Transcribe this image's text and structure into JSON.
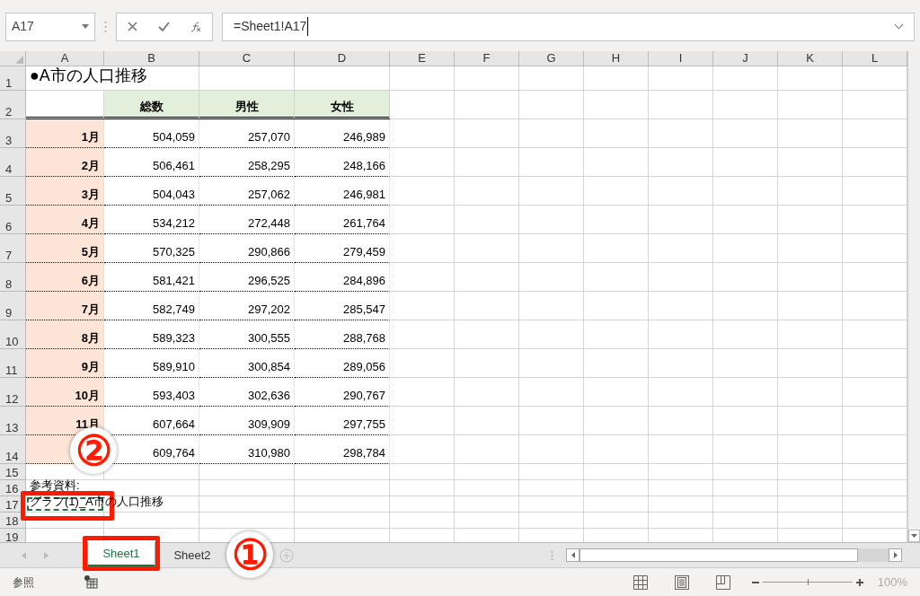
{
  "name_box": "A17",
  "formula": "=Sheet1!A17",
  "columns": [
    "A",
    "B",
    "C",
    "D",
    "E",
    "F",
    "G",
    "H",
    "I",
    "J",
    "K",
    "L"
  ],
  "rows": [
    {
      "number": "1",
      "kind": "title",
      "cells": [
        "●A市の人口推移"
      ]
    },
    {
      "number": "2",
      "kind": "header",
      "cells": [
        "",
        "総数",
        "男性",
        "女性"
      ]
    },
    {
      "number": "3",
      "kind": "data",
      "cells": [
        "1月",
        "504,059",
        "257,070",
        "246,989"
      ]
    },
    {
      "number": "4",
      "kind": "data",
      "cells": [
        "2月",
        "506,461",
        "258,295",
        "248,166"
      ]
    },
    {
      "number": "5",
      "kind": "data",
      "cells": [
        "3月",
        "504,043",
        "257,062",
        "246,981"
      ]
    },
    {
      "number": "6",
      "kind": "data",
      "cells": [
        "4月",
        "534,212",
        "272,448",
        "261,764"
      ]
    },
    {
      "number": "7",
      "kind": "data",
      "cells": [
        "5月",
        "570,325",
        "290,866",
        "279,459"
      ]
    },
    {
      "number": "8",
      "kind": "data",
      "cells": [
        "6月",
        "581,421",
        "296,525",
        "284,896"
      ]
    },
    {
      "number": "9",
      "kind": "data",
      "cells": [
        "7月",
        "582,749",
        "297,202",
        "285,547"
      ]
    },
    {
      "number": "10",
      "kind": "data",
      "cells": [
        "8月",
        "589,323",
        "300,555",
        "288,768"
      ]
    },
    {
      "number": "11",
      "kind": "data",
      "cells": [
        "9月",
        "589,910",
        "300,854",
        "289,056"
      ]
    },
    {
      "number": "12",
      "kind": "data",
      "cells": [
        "10月",
        "593,403",
        "302,636",
        "290,767"
      ]
    },
    {
      "number": "13",
      "kind": "data",
      "cells": [
        "11月",
        "607,664",
        "309,909",
        "297,755"
      ]
    },
    {
      "number": "14",
      "kind": "data",
      "cells": [
        "",
        "609,764",
        "310,980",
        "298,784"
      ]
    },
    {
      "number": "15",
      "kind": "note",
      "cells": []
    },
    {
      "number": "16",
      "kind": "note",
      "cells": [
        "参考資料:"
      ]
    },
    {
      "number": "17",
      "kind": "note",
      "marquee": true,
      "cells": [
        "グラフ(1)_A市の人口推移"
      ]
    },
    {
      "number": "18",
      "kind": "note",
      "cells": []
    },
    {
      "number": "19",
      "kind": "note",
      "cells": []
    }
  ],
  "sheet_tabs": [
    {
      "label": "Sheet1",
      "selected": true
    },
    {
      "label": "Sheet2",
      "selected": false
    }
  ],
  "annotations": [
    {
      "label": "①"
    },
    {
      "label": "②"
    }
  ],
  "status_bar": {
    "mode": "参照",
    "zoom": "100%",
    "level": 0.5
  }
}
